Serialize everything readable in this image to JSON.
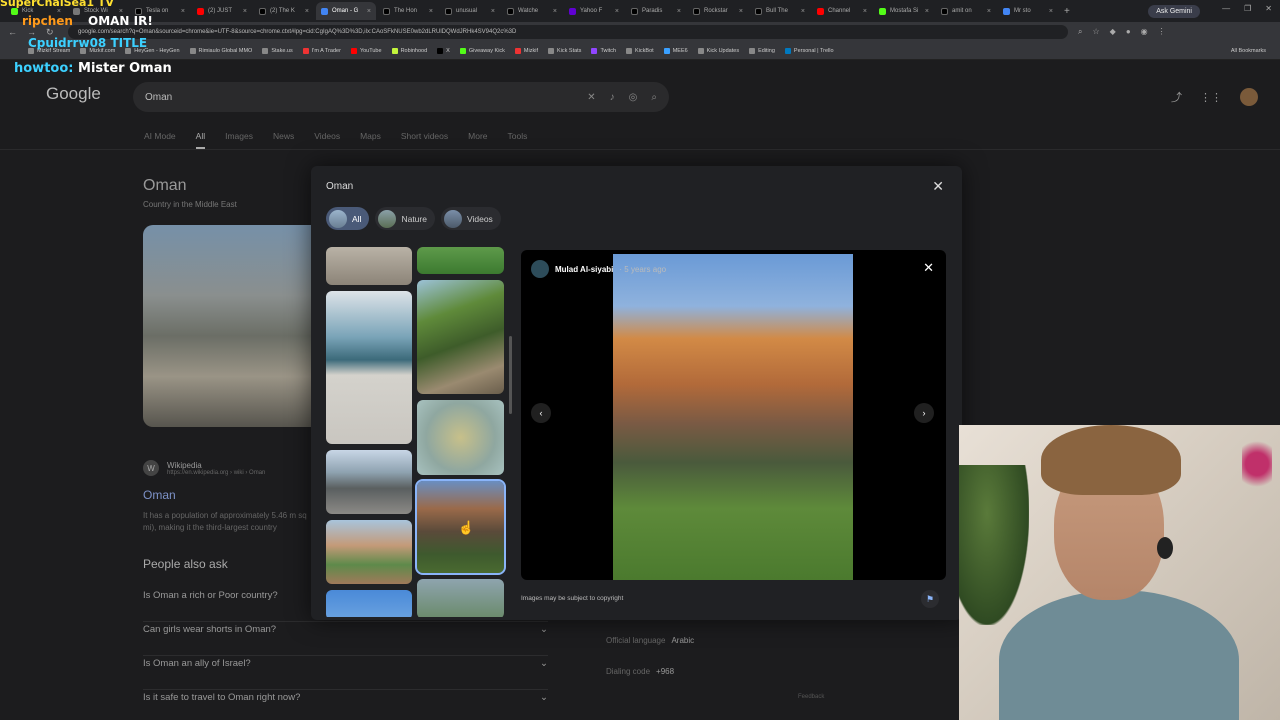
{
  "browser": {
    "tabs": [
      "Kick",
      "Stock Wi",
      "Tesla on",
      "(2) JUST",
      "(2) The K",
      "Oman - G",
      "The Hon",
      "unusual",
      "Watche",
      "Yahoo F",
      "Paradis",
      "Rockstar",
      "Bull The",
      "Channel",
      "Mostafa Si",
      "amit on",
      "Mr sto"
    ],
    "active_tab_index": 5,
    "ask_gemini": "Ask Gemini",
    "url": "google.com/search?q=Oman&sourceid=chrome&ie=UTF-8&source=chrome.ctxt#lpg=cid:CgIgAQ%3D%3D,ilx:CAoSFkNUSE0wb2dLRUlDQWdJRHk4SV94Q2c%3D",
    "bookmarks": [
      "Mizkif Stream",
      "Mizkif.com",
      "HeyGen - HeyGen",
      "Rimiaulo Global MMO",
      "Stake.us",
      "I'm A Trader",
      "YouTube",
      "Robinhood",
      "X",
      "Giveaway Kick",
      "Mizkif",
      "Kick Stats",
      "Twitch",
      "KickBot",
      "MEE6",
      "Kick Updates",
      "Editing",
      "Personal | Trello"
    ],
    "all_bookmarks": "All Bookmarks"
  },
  "overlay": {
    "line1": "SuperChaiSea1 TV",
    "line2a": "ripchen",
    "line2b": "OMAN IR!",
    "line3": "Cpuidrrw08 TITLE",
    "line4_user": "howtoo:",
    "line4_msg": "Mister Oman"
  },
  "google": {
    "logo": "Google",
    "query": "Oman",
    "tabs": [
      "AI Mode",
      "All",
      "Images",
      "News",
      "Videos",
      "Maps",
      "Short videos",
      "More",
      "Tools"
    ],
    "kp_title": "Oman",
    "kp_sub": "Country in the Middle East",
    "wiki_site": "Wikipedia",
    "wiki_url": "https://en.wikipedia.org › wiki › Oman",
    "wiki_link": "Oman",
    "wiki_text": "It has a population of approximately 5.46 m sq mi), making it the third-largest country",
    "paa_heading": "People also ask",
    "questions": [
      "Is Oman a rich or Poor country?",
      "Can girls wear shorts in Oman?",
      "Is Oman an ally of Israel?",
      "Is it safe to travel to Oman right now?"
    ],
    "facts": [
      {
        "label": "Official language",
        "value": "Arabic"
      },
      {
        "label": "Dialing code",
        "value": "+968"
      }
    ],
    "feedback": "Feedback"
  },
  "modal": {
    "title": "Oman",
    "chips": [
      "All",
      "Nature",
      "Videos"
    ],
    "author": "Mulad Al-siyabi",
    "time": "5 years ago",
    "copyright": "Images may be subject to copyright"
  },
  "colors": {
    "accent": "#8ab4f8",
    "chip_selected": "#4a5a78",
    "background": "#1c1c1e"
  }
}
